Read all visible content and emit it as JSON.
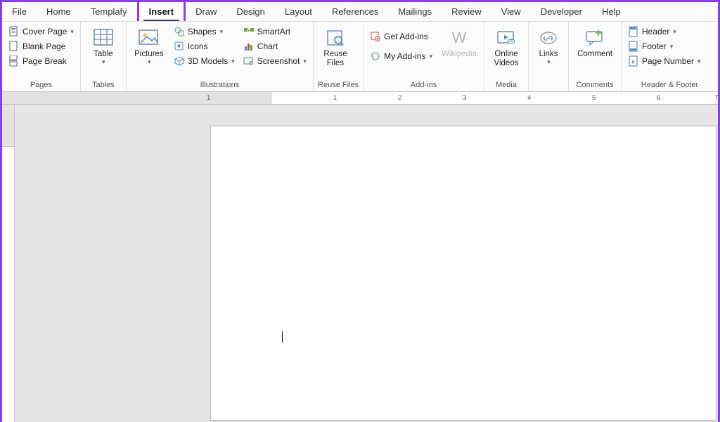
{
  "tabs": {
    "file": "File",
    "home": "Home",
    "templafy": "Templafy",
    "insert": "Insert",
    "draw": "Draw",
    "design": "Design",
    "layout": "Layout",
    "references": "References",
    "mailings": "Mailings",
    "review": "Review",
    "view": "View",
    "developer": "Developer",
    "help": "Help"
  },
  "ribbon": {
    "pages": {
      "cover_page": "Cover Page",
      "blank_page": "Blank Page",
      "page_break": "Page Break",
      "group": "Pages"
    },
    "tables": {
      "table": "Table",
      "group": "Tables"
    },
    "illustrations": {
      "pictures": "Pictures",
      "shapes": "Shapes",
      "icons": "Icons",
      "models": "3D Models",
      "smartart": "SmartArt",
      "chart": "Chart",
      "screenshot": "Screenshot",
      "group": "Illustrations"
    },
    "reuse": {
      "reuse_files": "Reuse\nFiles",
      "group": "Reuse Files"
    },
    "addins": {
      "get": "Get Add-ins",
      "my": "My Add-ins",
      "wikipedia": "Wikipedia",
      "group": "Add-ins"
    },
    "media": {
      "online_videos": "Online\nVideos",
      "group": "Media"
    },
    "links": {
      "links": "Links",
      "group": ""
    },
    "comments": {
      "comment": "Comment",
      "group": "Comments"
    },
    "headerfooter": {
      "header": "Header",
      "footer": "Footer",
      "page_number": "Page Number",
      "group": "Header & Footer"
    }
  },
  "ruler": {
    "nums": [
      "1",
      "1",
      "2",
      "3",
      "4",
      "5",
      "6",
      "7"
    ]
  }
}
